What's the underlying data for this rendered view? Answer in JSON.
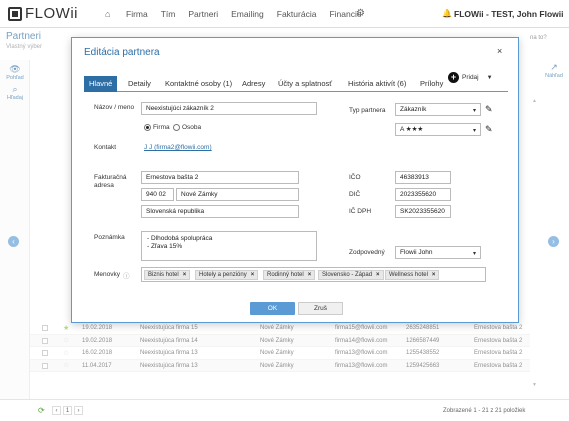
{
  "brand": {
    "name": "FLOWii"
  },
  "nav": {
    "items": [
      "Firma",
      "Tím",
      "Partneri",
      "Emailing",
      "Fakturácia",
      "Financie"
    ],
    "user": "FLOWii - TEST, John Flowii"
  },
  "page": {
    "title": "Partneri",
    "subtitle": "Vlastný výber",
    "left_rail": [
      {
        "icon": "eye-icon",
        "label": "Pohľad"
      },
      {
        "icon": "search-icon",
        "label": "Hľadaj"
      }
    ],
    "right_tools": "na to?",
    "right_rail": {
      "icon": "share-icon",
      "label": "Náhľad"
    }
  },
  "grid_rows": [
    {
      "date": "19.02.2018",
      "name": "Neexistujúca firma 15",
      "city": "Nové Zámky",
      "email": "firma15@flowii.com",
      "phone": "2635248851",
      "street": "Ernestova bašta 2",
      "starred": true
    },
    {
      "date": "19.02.2018",
      "name": "Neexistujúca firma 14",
      "city": "Nové Zámky",
      "email": "firma14@flowii.com",
      "phone": "1266587449",
      "street": "Ernestova bašta 2",
      "starred": false
    },
    {
      "date": "16.02.2018",
      "name": "Neexistujúca firma 13",
      "city": "Nové Zámky",
      "email": "firma13@flowii.com",
      "phone": "1255438552",
      "street": "Ernestova bašta 2",
      "starred": false
    },
    {
      "date": "11.04.2017",
      "name": "Neexistujúca firma 13",
      "city": "Nové Zámky",
      "email": "firma13@flowii.com",
      "phone": "1259425663",
      "street": "Ernestova bašta 2",
      "starred": false
    }
  ],
  "footer": {
    "pager": [
      "‹",
      "1",
      "›"
    ],
    "count": "Zobrazené 1 - 21 z 21 položiek"
  },
  "modal": {
    "title": "Editácia partnera",
    "close": "×",
    "tabs": [
      "Hlavné",
      "Detaily",
      "Kontaktné osoby (1)",
      "Adresy",
      "Účty a splatnosť",
      "História aktivít (6)",
      "Prílohy"
    ],
    "add_label": "Pridaj",
    "form": {
      "name_label": "Názov / meno",
      "name_value": "Neexistujúci zákazník 2",
      "radio_firma": "Firma",
      "radio_osoba": "Osoba",
      "type_label": "Typ partnera",
      "type_value": "Zákazník",
      "rating_value": "A ★★★",
      "contact_label": "Kontakt",
      "contact_value": "J J (firma2@flowii.com)",
      "address_label_1": "Fakturačná",
      "address_label_2": "adresa",
      "street": "Ernestova bašta 2",
      "zip": "940 02",
      "city": "Nové Zámky",
      "country": "Slovenská republika",
      "ico_label": "IČO",
      "ico_value": "46383913",
      "dic_label": "DIČ",
      "dic_value": "2023355620",
      "icdph_label": "IČ DPH",
      "icdph_value": "SK2023355620",
      "note_label": "Poznámka",
      "note_line1": "- Dlhodobá spolupráca",
      "note_line2": "- Zľava 15%",
      "owner_label": "Zodpovedný",
      "owner_value": "Flowii John",
      "tags_label": "Menovky",
      "tags": [
        "Biznis hotel",
        "Hotely a penzióny",
        "Rodinný hotel",
        "Slovensko - Západ",
        "Wellness hotel"
      ]
    },
    "ok_label": "OK",
    "cancel_label": "Zruš"
  }
}
